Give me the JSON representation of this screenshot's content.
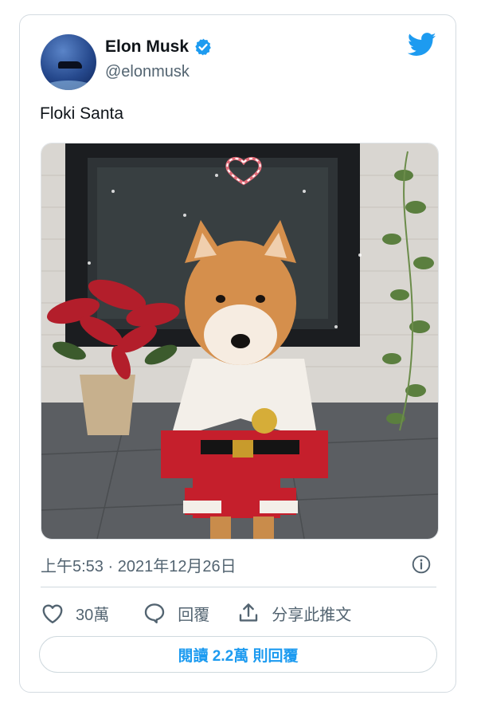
{
  "tweet": {
    "author_name": "Elon Musk",
    "author_handle": "@elonmusk",
    "text": "Floki Santa",
    "timestamp": "上午5:53 · 2021年12月26日",
    "likes": "30萬",
    "reply_label": "回覆",
    "share_label": "分享此推文",
    "read_replies": "閱讀 2.2萬 則回覆"
  },
  "icons": {
    "verified": "verified-badge-icon",
    "brand": "twitter-bird-icon",
    "info": "info-icon",
    "like": "heart-icon",
    "reply": "speech-bubble-icon",
    "share": "share-upload-icon"
  },
  "colors": {
    "brand_blue": "#1d9bf0",
    "secondary_text": "#536471",
    "primary_text": "#0f1419",
    "border": "#cfd9de"
  }
}
